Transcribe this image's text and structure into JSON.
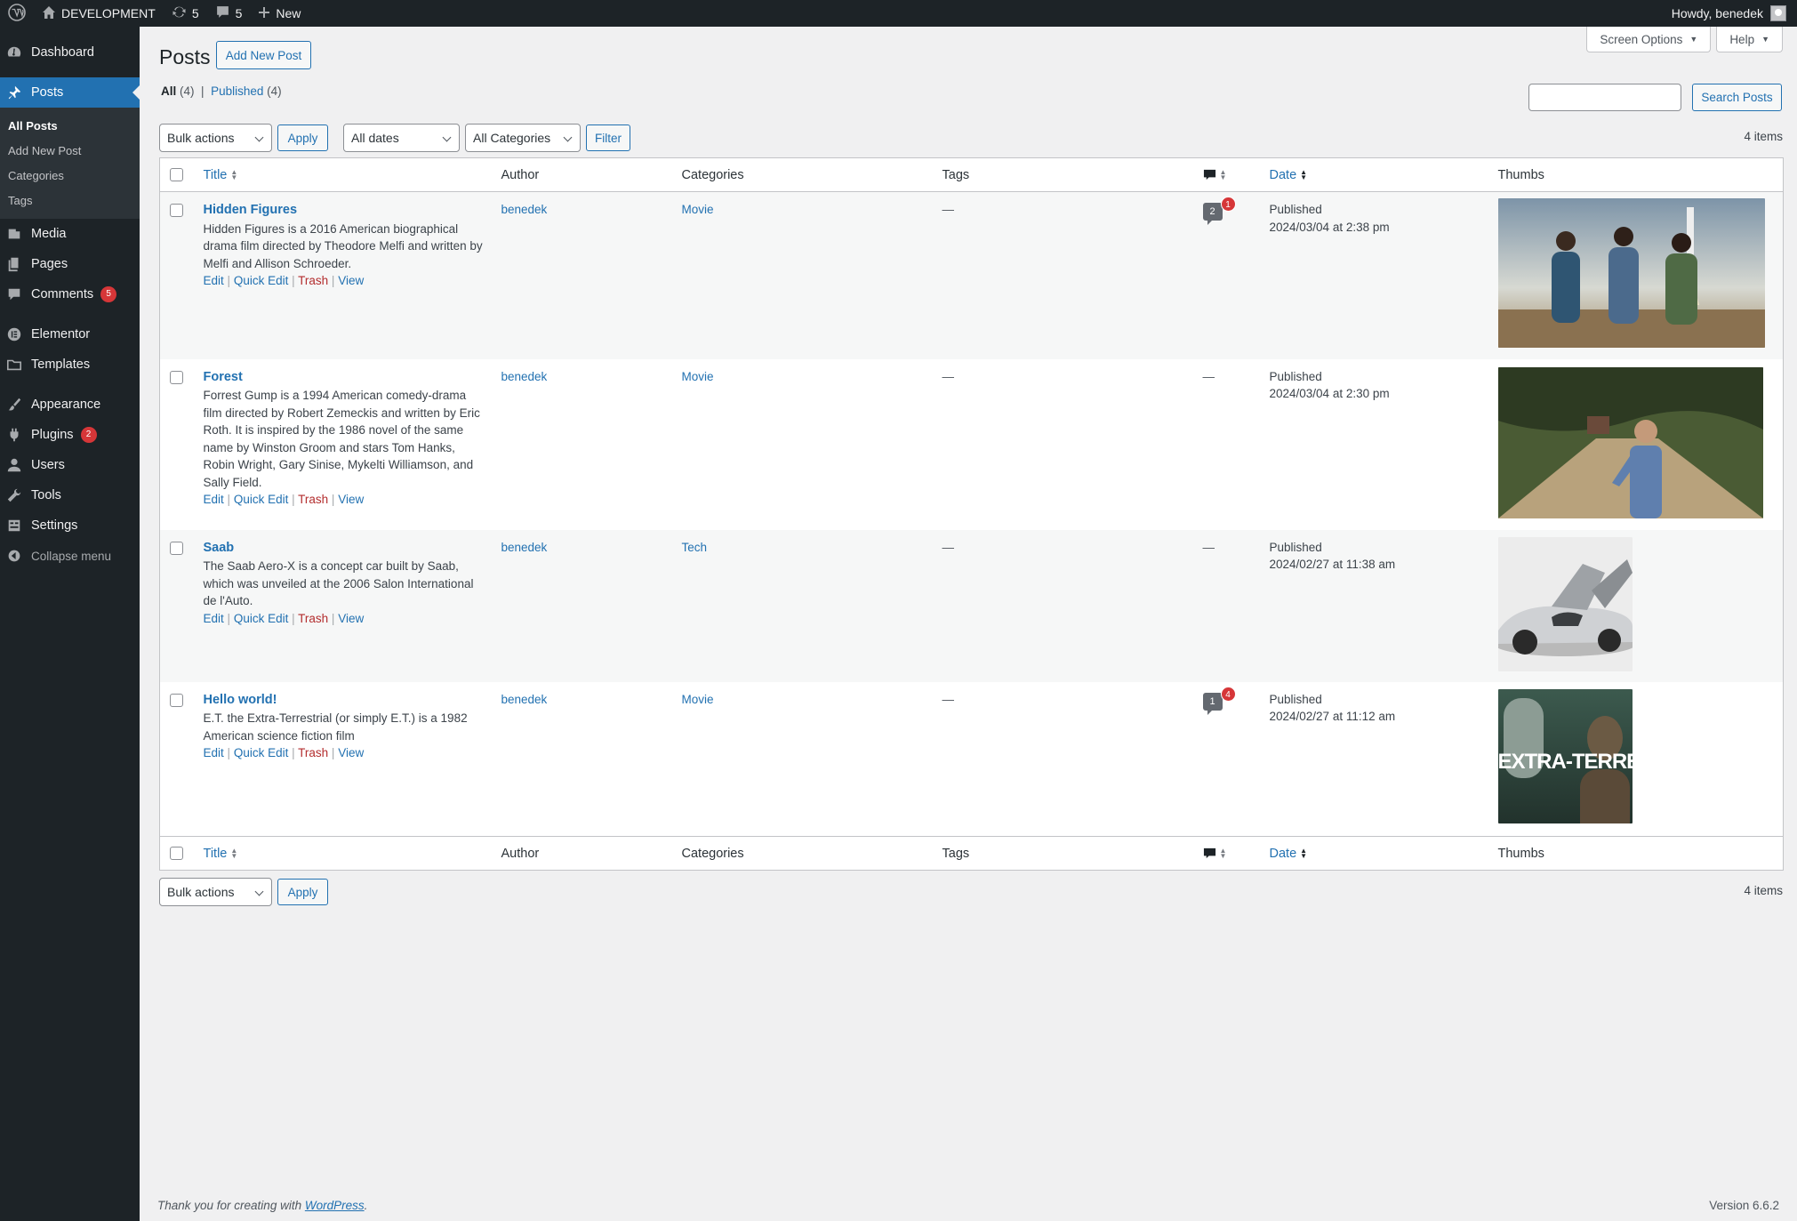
{
  "adminbar": {
    "site_name": "DEVELOPMENT",
    "updates_count": "5",
    "comments_count": "5",
    "new_label": "New",
    "howdy": "Howdy, benedek"
  },
  "sidebar": {
    "dashboard": "Dashboard",
    "posts": "Posts",
    "all_posts": "All Posts",
    "add_new_post": "Add New Post",
    "categories": "Categories",
    "tags": "Tags",
    "media": "Media",
    "pages": "Pages",
    "comments": "Comments",
    "comments_badge": "5",
    "elementor": "Elementor",
    "templates": "Templates",
    "appearance": "Appearance",
    "plugins": "Plugins",
    "plugins_badge": "2",
    "users": "Users",
    "tools": "Tools",
    "settings": "Settings",
    "collapse": "Collapse menu"
  },
  "screen_meta": {
    "screen_options": "Screen Options",
    "help": "Help"
  },
  "page": {
    "title": "Posts",
    "add_new": "Add New Post",
    "view_all": "All",
    "view_all_count": "(4)",
    "sep": "|",
    "view_published": "Published",
    "view_published_count": "(4)",
    "search_button": "Search Posts",
    "bulk_actions": "Bulk actions",
    "apply": "Apply",
    "all_dates": "All dates",
    "all_categories": "All Categories",
    "filter": "Filter",
    "items_count": "4 items"
  },
  "columns": {
    "title": "Title",
    "author": "Author",
    "categories": "Categories",
    "tags": "Tags",
    "date": "Date",
    "thumbs": "Thumbs"
  },
  "row_actions": {
    "edit": "Edit",
    "quick_edit": "Quick Edit",
    "trash": "Trash",
    "view": "View",
    "sep": "|"
  },
  "posts": [
    {
      "title": "Hidden Figures",
      "excerpt": "Hidden Figures is a 2016 American biographical drama film directed by Theodore Melfi and written by Melfi and Allison Schroeder.",
      "author": "benedek",
      "category": "Movie",
      "tags": "—",
      "comments": "2",
      "pending": "1",
      "status": "Published",
      "date": "2024/03/04 at 2:38 pm"
    },
    {
      "title": "Forest",
      "excerpt": "Forrest Gump is a 1994 American comedy-drama film directed by Robert Zemeckis and written by Eric Roth. It is inspired by the 1986 novel of the same name by Winston Groom and stars Tom Hanks, Robin Wright, Gary Sinise, Mykelti Williamson, and Sally Field.",
      "author": "benedek",
      "category": "Movie",
      "tags": "—",
      "comments": "—",
      "status": "Published",
      "date": "2024/03/04 at 2:30 pm"
    },
    {
      "title": "Saab",
      "excerpt": "The Saab Aero-X is a concept car built by Saab, which was unveiled at the 2006 Salon International de l'Auto.",
      "author": "benedek",
      "category": "Tech",
      "tags": "—",
      "comments": "—",
      "status": "Published",
      "date": "2024/02/27 at 11:38 am"
    },
    {
      "title": "Hello world!",
      "excerpt": "E.T. the Extra-Terrestrial (or simply E.T.) is a 1982 American science fiction film",
      "author": "benedek",
      "category": "Movie",
      "tags": "—",
      "comments": "1",
      "pending": "4",
      "status": "Published",
      "date": "2024/02/27 at 11:12 am",
      "thumb_text": "EXTRA-TERRESTRI"
    }
  ],
  "footer": {
    "thanks": "Thank you for creating with ",
    "wordpress": "WordPress",
    "period": ".",
    "version": "Version 6.6.2"
  }
}
